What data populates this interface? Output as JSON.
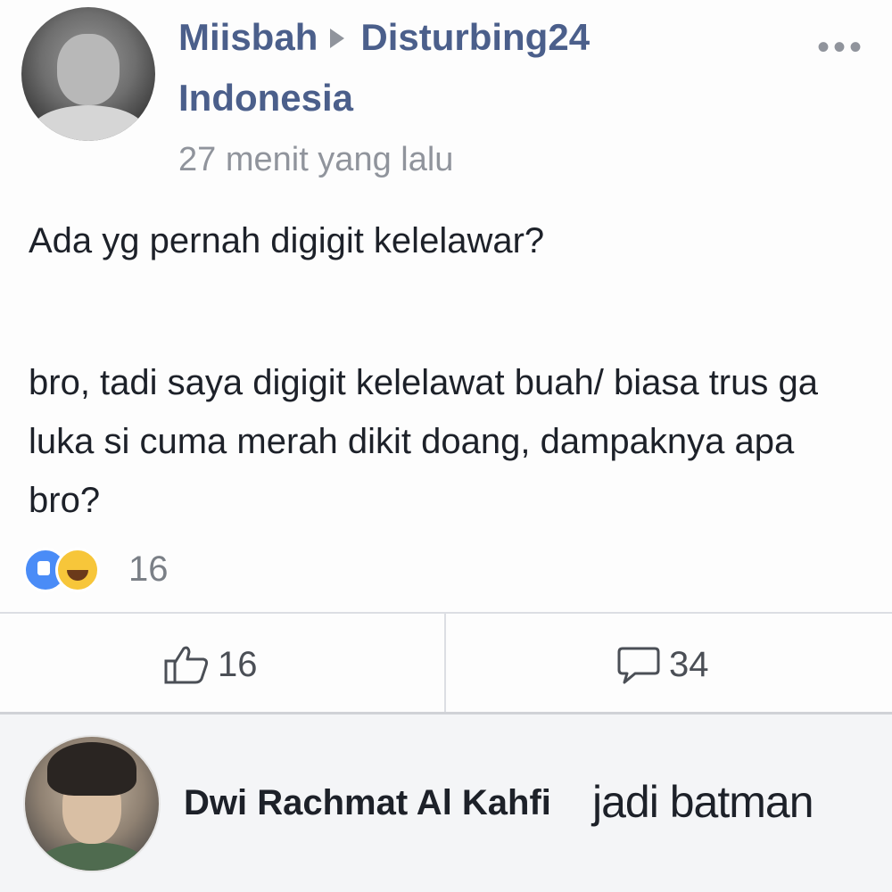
{
  "post": {
    "author": "Miisbah",
    "group": "Disturbing24",
    "group_line2": "Indonesia",
    "timestamp": "27 menit yang lalu",
    "more_label": "•••",
    "question": "Ada yg pernah digigit kelelawar?",
    "message": "bro, tadi saya digigit kelelawat buah/ biasa trus ga luka si cuma merah dikit doang, dampaknya apa bro?",
    "reaction_count": "16",
    "reactions": [
      "like-icon",
      "haha-icon"
    ]
  },
  "actions": {
    "like_count": "16",
    "comment_count": "34"
  },
  "comment": {
    "author": "Dwi Rachmat Al Kahfi",
    "text": "jadi batman"
  },
  "colors": {
    "link": "#4b5f8b",
    "muted": "#90949c",
    "like_blue": "#4a8cf7",
    "haha_yellow": "#f7c63a"
  }
}
